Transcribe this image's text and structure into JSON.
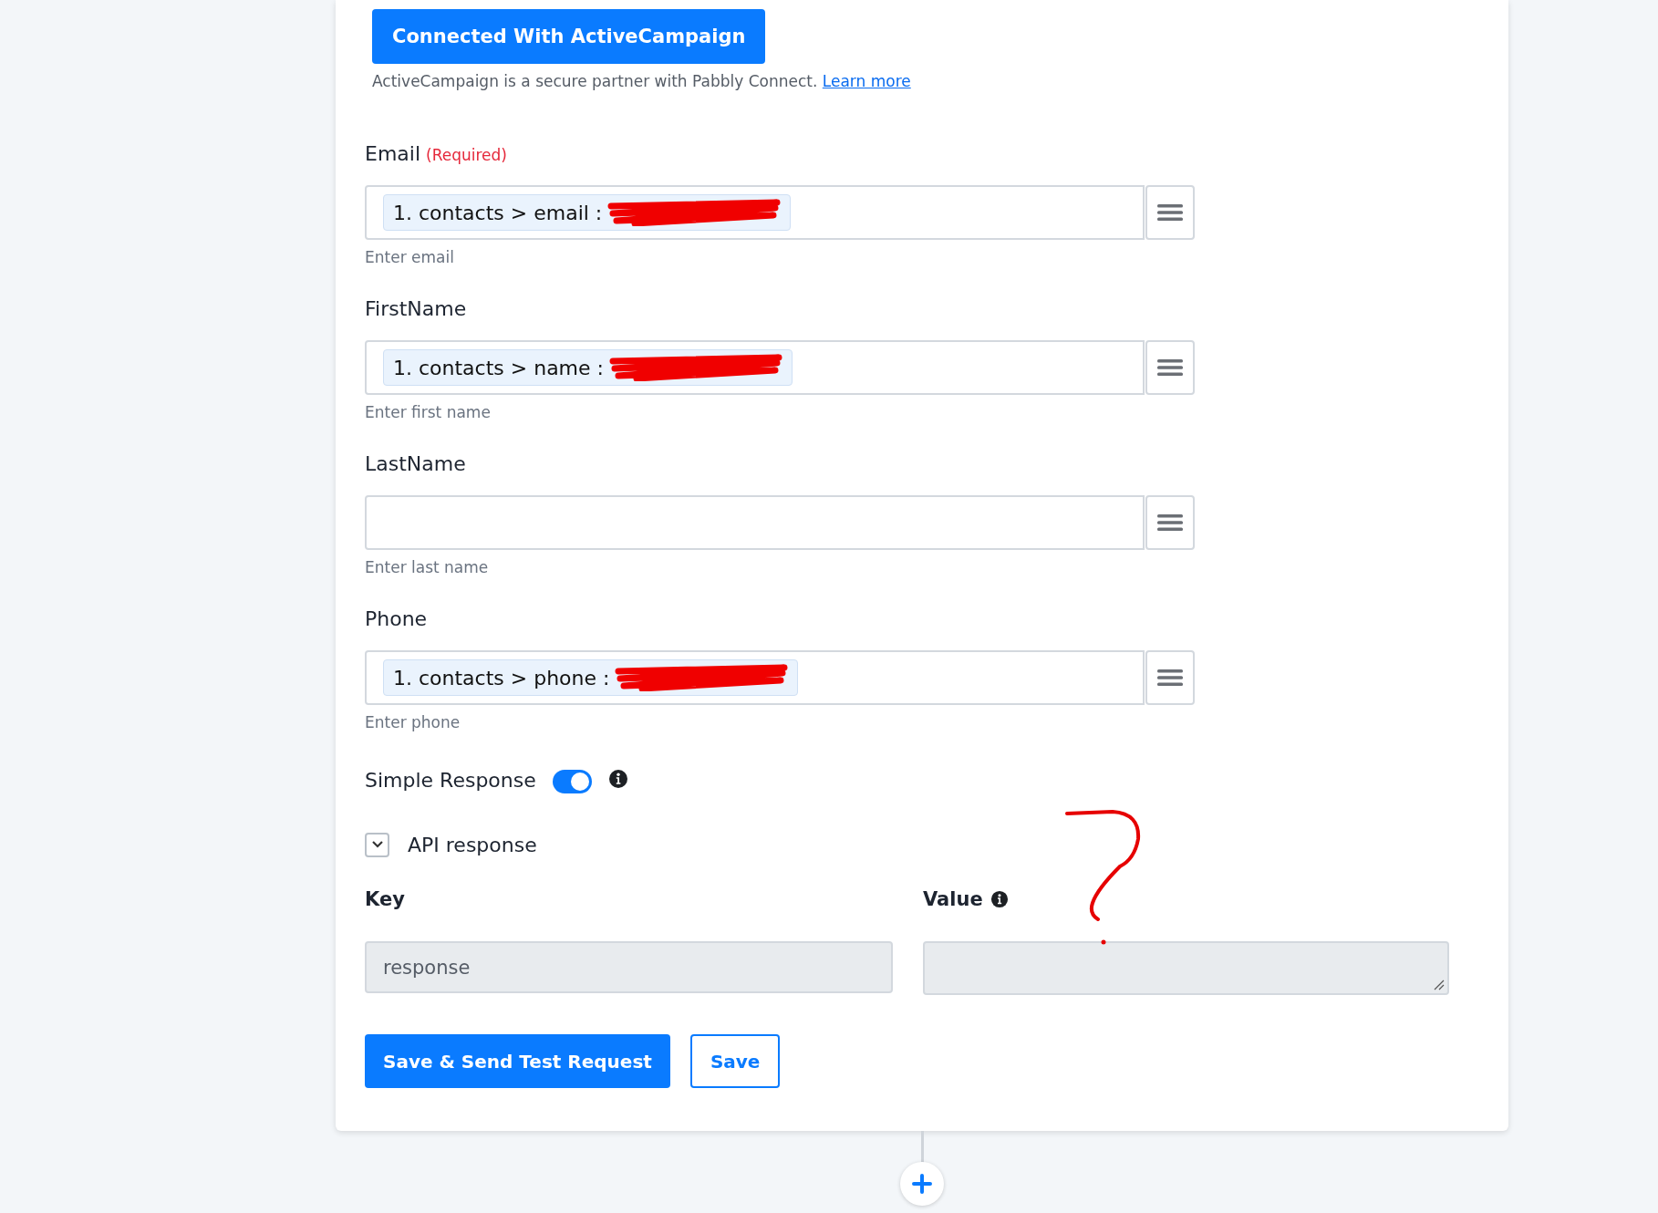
{
  "connect_button": "Connected With ActiveCampaign",
  "partner_note": {
    "text": "ActiveCampaign is a secure partner with Pabbly Connect.",
    "link": "Learn more"
  },
  "fields": [
    {
      "label": "Email",
      "required": "(Required)",
      "token": "1. contacts > email :",
      "redacted": true,
      "help": "Enter email"
    },
    {
      "label": "FirstName",
      "token": "1. contacts > name :",
      "redacted": true,
      "help": "Enter first name"
    },
    {
      "label": "LastName",
      "help": "Enter last name"
    },
    {
      "label": "Phone",
      "token": "1. contacts > phone :",
      "redacted": true,
      "help": "Enter phone"
    }
  ],
  "simple_response": {
    "label": "Simple Response",
    "on": true
  },
  "api_response": {
    "label": "API response",
    "expanded": true
  },
  "key_value": {
    "key_label": "Key",
    "value_label": "Value",
    "key": "response"
  },
  "buttons": [
    {
      "label": "Save & Send Test Request",
      "kind": "primary"
    },
    {
      "label": "Save",
      "kind": "outline"
    }
  ],
  "annotation": true
}
